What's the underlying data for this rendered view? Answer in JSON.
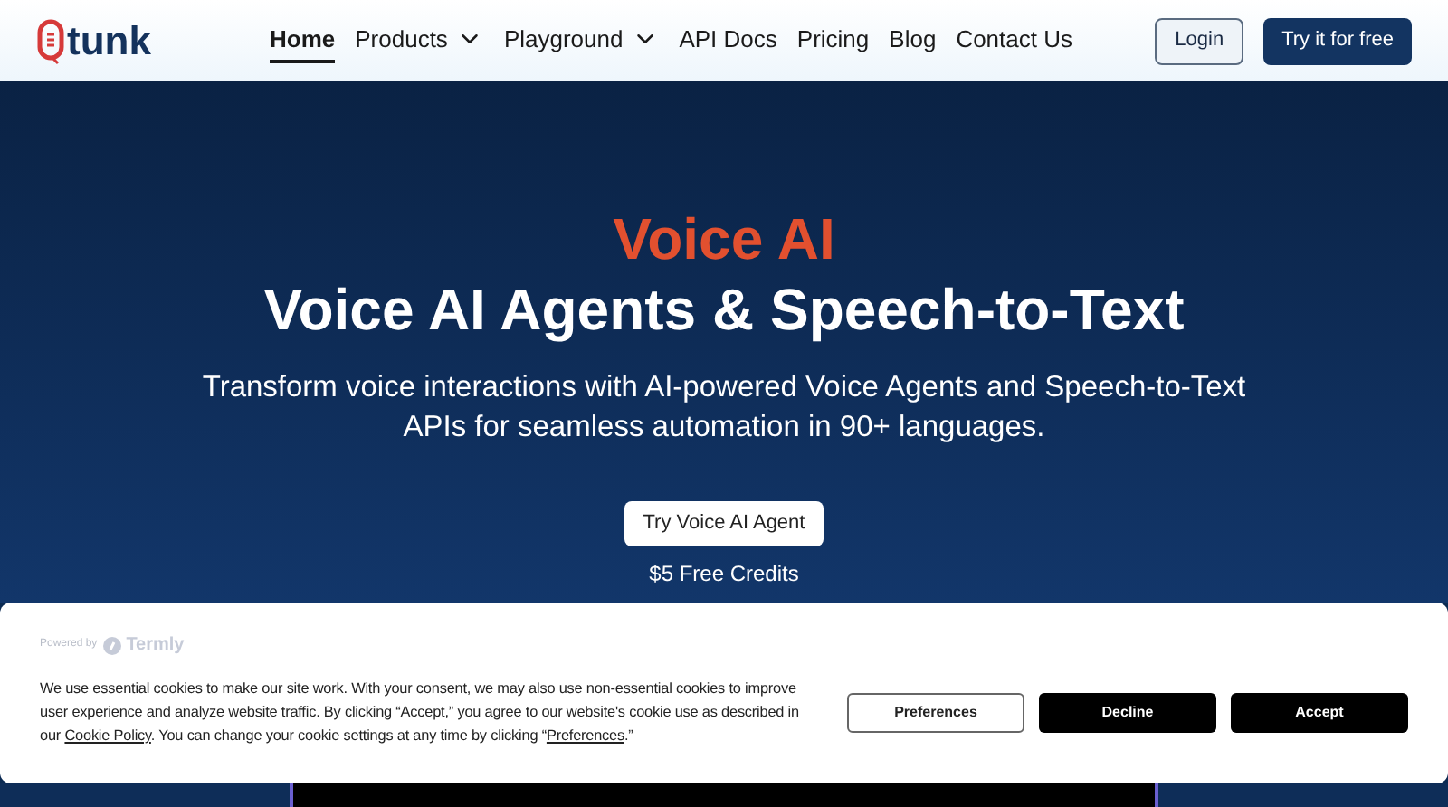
{
  "header": {
    "logo": "tunk",
    "nav": [
      {
        "label": "Home",
        "selected": true,
        "dropdown": false
      },
      {
        "label": "Products",
        "selected": false,
        "dropdown": true
      },
      {
        "label": "Playground",
        "selected": false,
        "dropdown": true
      },
      {
        "label": "API Docs",
        "selected": false,
        "dropdown": false
      },
      {
        "label": "Pricing",
        "selected": false,
        "dropdown": false
      },
      {
        "label": "Blog",
        "selected": false,
        "dropdown": false
      },
      {
        "label": "Contact Us",
        "selected": false,
        "dropdown": false
      }
    ],
    "login": "Login",
    "cta": "Try it for free"
  },
  "hero": {
    "eyebrow": "Voice AI",
    "title": "Voice AI Agents & Speech-to-Text",
    "subtitle": "Transform voice interactions with AI-powered Voice Agents and Speech-to-Text APIs for seamless automation in 90+ languages.",
    "button": "Try Voice AI Agent",
    "note": "$5 Free Credits"
  },
  "cookie_banner": {
    "powered_by": "Powered by",
    "brand": "Termly",
    "message": [
      {
        "kind": "text",
        "text": "We use essential cookies to make our site work. With your consent, we may also use non-essential cookies to improve user experience and analyze website traffic. By clicking “Accept,” you agree to our website's cookie use as described in our "
      },
      {
        "kind": "link",
        "text": "Cookie Policy"
      },
      {
        "kind": "text",
        "text": ". You can change your cookie settings at any time by clicking “"
      },
      {
        "kind": "link",
        "text": "Preferences"
      },
      {
        "kind": "text",
        "text": ".”"
      }
    ],
    "buttons": [
      {
        "label": "Preferences",
        "kind": "outline"
      },
      {
        "label": "Decline",
        "kind": "solid"
      },
      {
        "label": "Accept",
        "kind": "solid"
      }
    ]
  }
}
